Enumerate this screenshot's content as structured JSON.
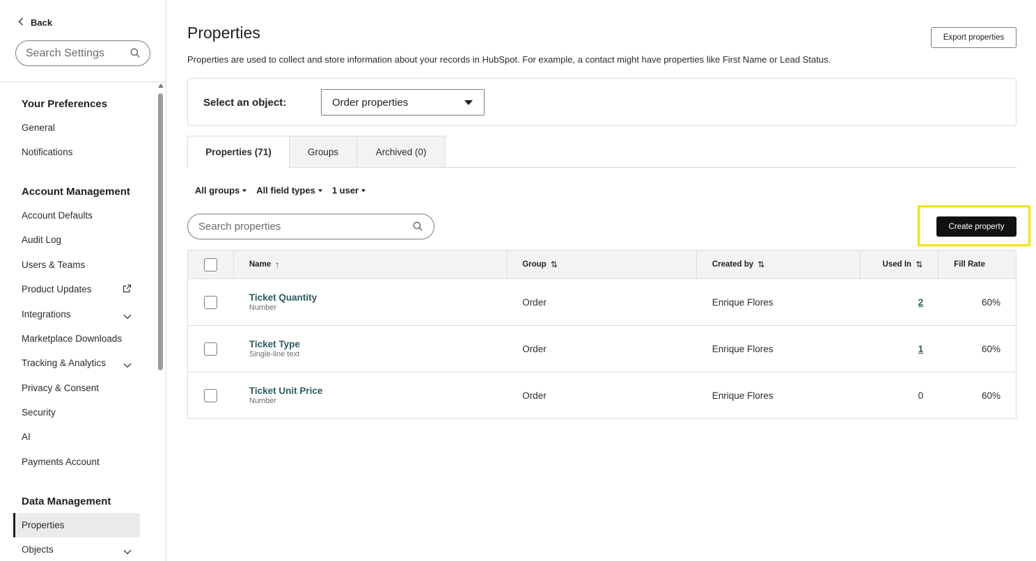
{
  "sidebar": {
    "back_label": "Back",
    "search_placeholder": "Search Settings",
    "sections": {
      "preferences": "Your Preferences",
      "account": "Account Management",
      "data": "Data Management"
    },
    "items": {
      "general": "General",
      "notifications": "Notifications",
      "account_defaults": "Account Defaults",
      "audit_log": "Audit Log",
      "users_teams": "Users & Teams",
      "product_updates": "Product Updates",
      "integrations": "Integrations",
      "marketplace_downloads": "Marketplace Downloads",
      "tracking_analytics": "Tracking & Analytics",
      "privacy_consent": "Privacy & Consent",
      "security": "Security",
      "ai": "AI",
      "payments_account": "Payments Account",
      "properties": "Properties",
      "objects": "Objects"
    }
  },
  "main": {
    "title": "Properties",
    "export_label": "Export properties",
    "description": "Properties are used to collect and store information about your records in HubSpot. For example, a contact might have properties like First Name or Lead Status.",
    "object_label": "Select an object:",
    "object_value": "Order properties",
    "tabs": [
      "Properties (71)",
      "Groups",
      "Archived (0)"
    ],
    "filters": [
      "All groups",
      "All field types",
      "1 user"
    ],
    "search_placeholder": "Search properties",
    "create_label": "Create property"
  },
  "table": {
    "headers": {
      "name": "Name",
      "name_sort": "↑",
      "group": "Group",
      "created_by": "Created by",
      "used_in": "Used In",
      "fill_rate": "Fill Rate",
      "sort_both": "⇅"
    },
    "rows": [
      {
        "name": "Ticket Quantity",
        "type": "Number",
        "group": "Order",
        "created_by": "Enrique Flores",
        "used_in": "2",
        "fill_rate": "60%"
      },
      {
        "name": "Ticket Type",
        "type": "Single-line text",
        "group": "Order",
        "created_by": "Enrique Flores",
        "used_in": "1",
        "fill_rate": "60%"
      },
      {
        "name": "Ticket Unit Price",
        "type": "Number",
        "group": "Order",
        "created_by": "Enrique Flores",
        "used_in": "0",
        "fill_rate": "60%"
      }
    ]
  },
  "colors": {
    "link": "#2d5b5f",
    "primary_button": "#111111",
    "highlight": "#f2e300"
  },
  "icons": [
    "chevron-left-icon",
    "search-icon",
    "external-link-icon",
    "chevron-down-icon",
    "caret-down-icon"
  ]
}
